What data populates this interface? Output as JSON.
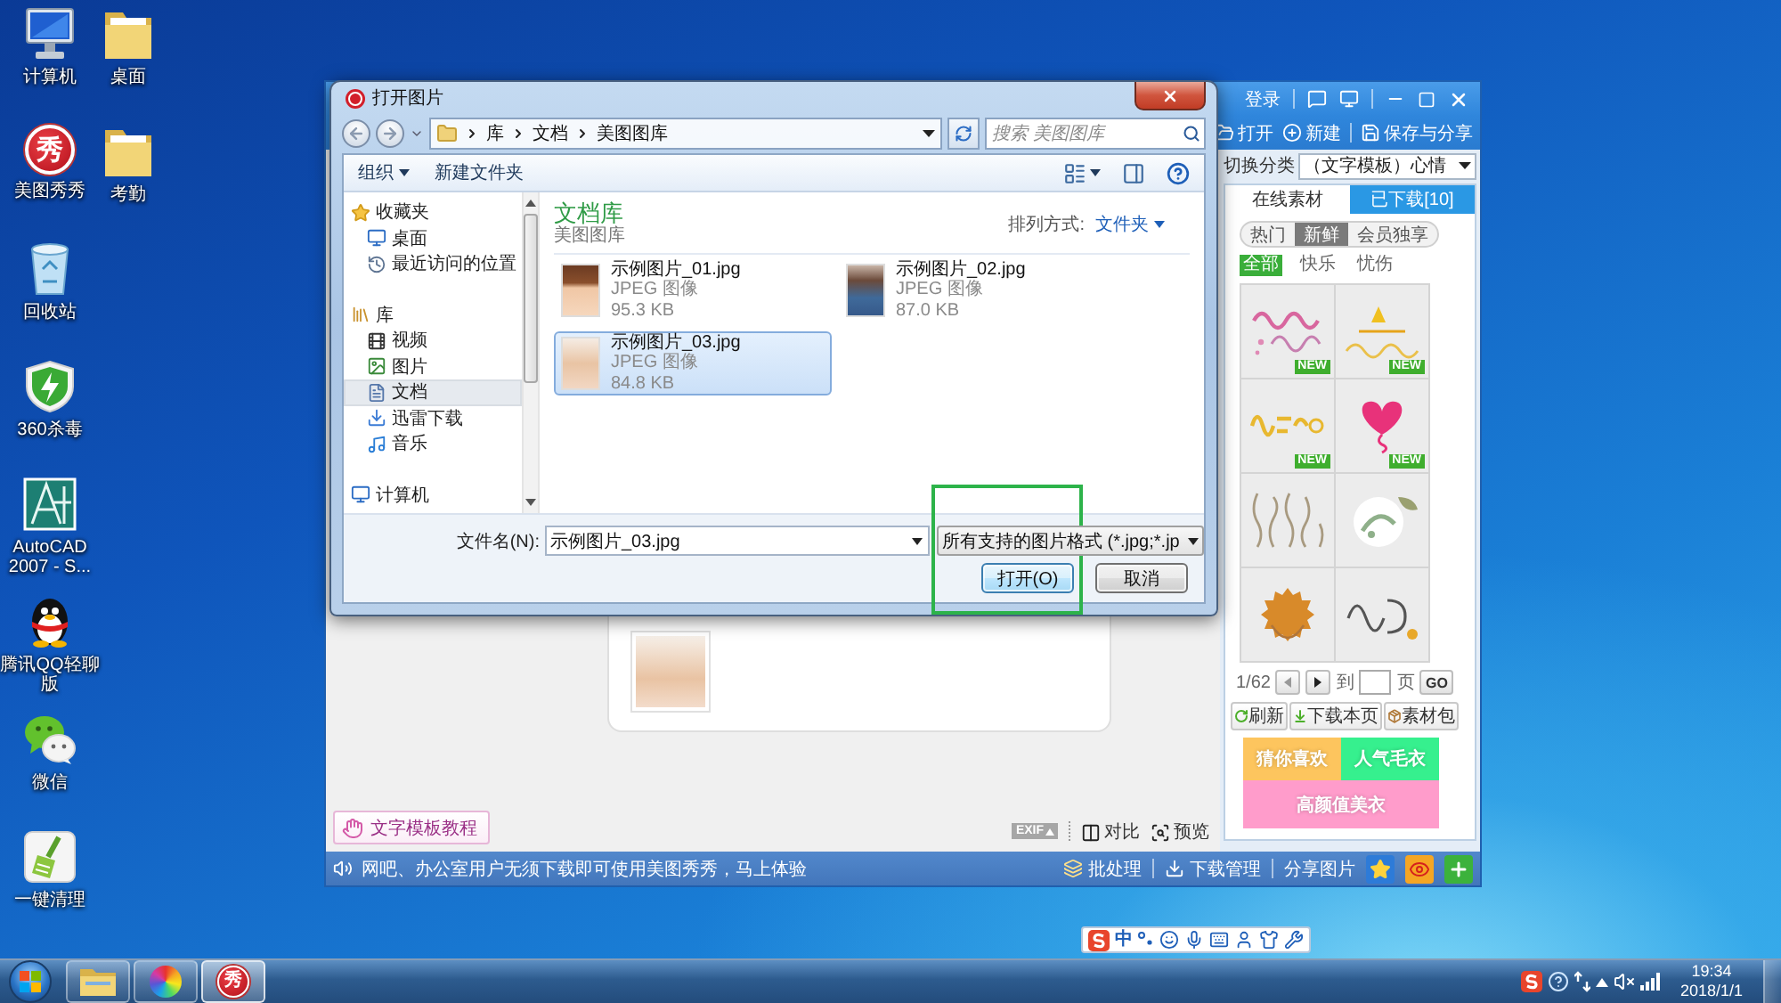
{
  "desktop_icons": [
    {
      "label": "计算机",
      "kind": "computer"
    },
    {
      "label": "桌面",
      "kind": "folder"
    },
    {
      "label": "美图秀秀",
      "kind": "meitu",
      "glyph": "秀"
    },
    {
      "label": "考勤",
      "kind": "folder"
    },
    {
      "label": "回收站",
      "kind": "recycle-bin"
    },
    {
      "label": "360杀毒",
      "kind": "shield"
    },
    {
      "label": "AutoCAD 2007 - S...",
      "kind": "cad"
    },
    {
      "label": "腾讯QQ轻聊版",
      "kind": "penguin"
    },
    {
      "label": "微信",
      "kind": "chat"
    },
    {
      "label": "一键清理",
      "kind": "broom"
    }
  ],
  "photo_editor": {
    "login": "登录",
    "toolbar": [
      {
        "label": "打开",
        "kind": "open"
      },
      {
        "label": "新建",
        "kind": "new"
      },
      {
        "label": "保存与分享",
        "kind": "save"
      }
    ],
    "category": {
      "label": "切换分类",
      "value": "（文字模板）心情"
    },
    "tabs": [
      {
        "label": "在线素材",
        "selected": true
      },
      {
        "label": "已下载[10]",
        "selected": false
      }
    ],
    "filters": [
      {
        "label": "热门",
        "selected": false
      },
      {
        "label": "新鲜",
        "selected": true
      },
      {
        "label": "会员独享",
        "selected": false
      }
    ],
    "moods": [
      {
        "label": "全部",
        "selected": true
      },
      {
        "label": "快乐",
        "selected": false
      },
      {
        "label": "忧伤",
        "selected": false
      }
    ],
    "templates": [
      {
        "kind": "script",
        "badge": "NEW"
      },
      {
        "kind": "cake",
        "badge": "NEW"
      },
      {
        "kind": "brush",
        "badge": "NEW"
      },
      {
        "kind": "heart",
        "badge": "NEW"
      },
      {
        "kind": "sketch"
      },
      {
        "kind": "leaf"
      },
      {
        "kind": "bloom"
      },
      {
        "kind": "ink"
      }
    ],
    "pager": {
      "page": "1/62",
      "goto": "到",
      "unit": "页",
      "go": "GO"
    },
    "panel_buttons": [
      {
        "label": "刷新",
        "kind": "refresh"
      },
      {
        "label": "下载本页",
        "kind": "download"
      },
      {
        "label": "素材包",
        "kind": "package"
      }
    ],
    "promos": [
      {
        "label": "猜你喜欢",
        "color": "#fdc55e"
      },
      {
        "label": "人气毛衣",
        "color": "#36f08e"
      },
      {
        "label": "高颜值美衣",
        "color": "#ff9ccb"
      }
    ],
    "tutorial": "文字模板教程",
    "view_tools": [
      {
        "label": "EXIF",
        "kind": "exif"
      },
      {
        "label": "对比",
        "kind": "compare"
      },
      {
        "label": "预览",
        "kind": "preview"
      }
    ],
    "status_message": "网吧、办公室用户无须下载即可使用美图秀秀，马上体验",
    "status_actions": [
      {
        "label": "批处理",
        "kind": "batch"
      },
      {
        "label": "下载管理",
        "kind": "download"
      },
      {
        "label": "分享图片",
        "kind": "share"
      }
    ]
  },
  "open_dialog": {
    "title": "打开图片",
    "breadcrumb": [
      "库",
      "文档",
      "美图图库"
    ],
    "search": {
      "placeholder": "搜索 美图图库"
    },
    "toolbar": [
      {
        "label": "组织",
        "kind": "menu"
      },
      {
        "label": "新建文件夹",
        "kind": "button"
      }
    ],
    "nav": [
      {
        "label": "收藏夹",
        "kind": "favorites",
        "selected": false,
        "children": [
          {
            "label": "桌面",
            "kind": "desktop",
            "selected": false
          },
          {
            "label": "最近访问的位置",
            "kind": "recent",
            "selected": false
          }
        ]
      },
      {
        "label": "库",
        "kind": "library",
        "selected": false,
        "children": [
          {
            "label": "视频",
            "kind": "video",
            "selected": false
          },
          {
            "label": "图片",
            "kind": "pictures",
            "selected": false
          },
          {
            "label": "文档",
            "kind": "documents",
            "selected": true
          },
          {
            "label": "迅雷下载",
            "kind": "downloads",
            "selected": false
          },
          {
            "label": "音乐",
            "kind": "music",
            "selected": false
          }
        ]
      },
      {
        "label": "计算机",
        "kind": "computer",
        "selected": false
      }
    ],
    "library": {
      "title": "文档库",
      "subtitle": "美图图库"
    },
    "arrange": {
      "label": "排列方式:",
      "value": "文件夹"
    },
    "files": [
      {
        "name": "示例图片_01.jpg",
        "type": "JPEG 图像",
        "size": "95.3 KB",
        "selected": false
      },
      {
        "name": "示例图片_02.jpg",
        "type": "JPEG 图像",
        "size": "87.0 KB",
        "selected": false
      },
      {
        "name": "示例图片_03.jpg",
        "type": "JPEG 图像",
        "size": "84.8 KB",
        "selected": true
      }
    ],
    "filename": {
      "label": "文件名(N):",
      "value": "示例图片_03.jpg"
    },
    "file_type": "所有支持的图片格式 (*.jpg;*.jp",
    "buttons": [
      {
        "label": "打开(O)",
        "kind": "primary"
      },
      {
        "label": "取消",
        "kind": "secondary"
      }
    ]
  },
  "ime_bar": {
    "mode": "中"
  },
  "taskbar": {
    "apps": [
      {
        "kind": "explorer",
        "selected": false
      },
      {
        "kind": "color-wheel",
        "selected": false
      },
      {
        "kind": "meitu",
        "glyph": "秀",
        "selected": true
      }
    ],
    "time": "19:34",
    "date": "2018/1/1"
  }
}
